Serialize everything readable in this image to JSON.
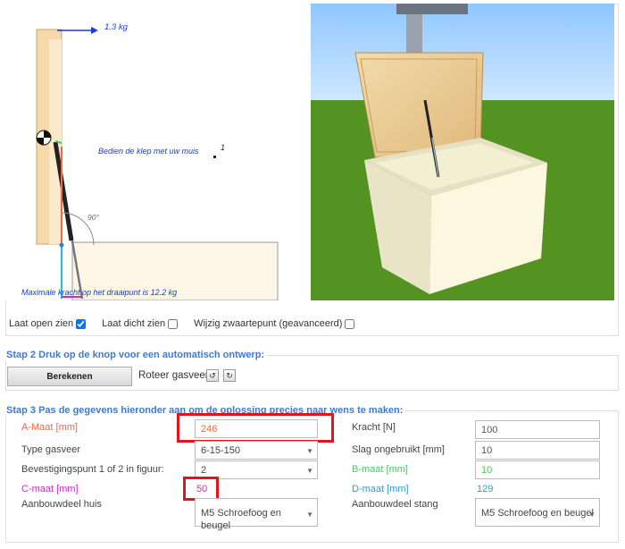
{
  "diagram": {
    "force_top": "1.3 kg",
    "instruction": "Bedien de klep met uw muis",
    "marker_label": "1",
    "angle_label": "90°",
    "max_force": "Maximale kracht op het draaipunt is 12.2 kg"
  },
  "checkboxes": [
    {
      "label": "Laat open zien",
      "checked": true
    },
    {
      "label": "Laat dicht zien",
      "checked": false
    },
    {
      "label": "Wijzig zwaartepunt (geavanceerd)",
      "checked": false
    }
  ],
  "step2": {
    "title": "Stap 2 Druk op de knop voor een automatisch ontwerp:",
    "calc_button": "Berekenen",
    "rotate_label": "Roteer gasveer",
    "rotate_left": "↺",
    "rotate_right": "↻"
  },
  "step3": {
    "title": "Stap 3 Pas de gegevens hieronder aan om de oplossing precies naar wens te maken:",
    "a_label": "A-Maat [mm]",
    "a_value": "246",
    "type_label": "Type gasveer",
    "type_value": "6-15-150",
    "bev_label": "Bevestigingspunt 1 of 2 in figuur:",
    "bev_value": "2",
    "c_label": "C-maat [mm]",
    "c_value": "50",
    "huis_label": "Aanbouwdeel huis",
    "huis_value": "M5 Schroefoog en beugel",
    "kracht_label": "Kracht [N]",
    "kracht_value": "100",
    "slag_label": "Slag ongebruikt [mm]",
    "slag_value": "10",
    "b_label": "B-maat [mm]",
    "b_value": "10",
    "d_label": "D-maat [mm]",
    "d_value": "129",
    "stang_label": "Aanbouwdeel stang",
    "stang_value": "M5 Schroefoog en beugel"
  },
  "colors": {
    "a_color": "#f06a3c",
    "b_color": "#3ccf5a",
    "c_color": "#e020d0",
    "d_color": "#2a9bd8",
    "title_blue": "#3a7bd5",
    "highlight_red": "#e0151d"
  }
}
